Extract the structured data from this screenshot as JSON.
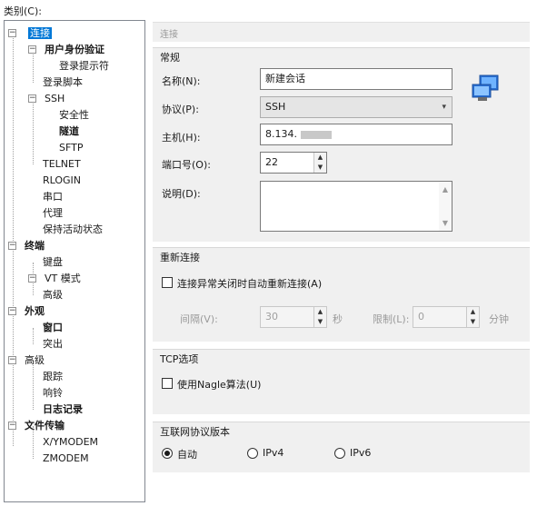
{
  "category_label": "类别(C):",
  "tree": {
    "connection": "连接",
    "user_auth": "用户身份验证",
    "login_prompt": "登录提示符",
    "login_script": "登录脚本",
    "ssh": "SSH",
    "security": "安全性",
    "tunnel": "隧道",
    "sftp": "SFTP",
    "telnet": "TELNET",
    "rlogin": "RLOGIN",
    "serial": "串口",
    "proxy": "代理",
    "keepalive": "保持活动状态",
    "terminal": "终端",
    "keyboard": "键盘",
    "vt_mode": "VT 模式",
    "advanced1": "高级",
    "appearance": "外观",
    "window": "窗口",
    "highlight": "突出",
    "advanced2": "高级",
    "trace": "跟踪",
    "bell": "响铃",
    "logging": "日志记录",
    "file_transfer": "文件传输",
    "xymodem": "X/YMODEM",
    "zmodem": "ZMODEM"
  },
  "header": "连接",
  "general": {
    "title": "常规",
    "name_label": "名称(N):",
    "name_value": "新建会话",
    "protocol_label": "协议(P):",
    "protocol_value": "SSH",
    "host_label": "主机(H):",
    "host_value": "8.134.",
    "port_label": "端口号(O):",
    "port_value": "22",
    "desc_label": "说明(D):"
  },
  "reconnect": {
    "title": "重新连接",
    "checkbox_label": "连接异常关闭时自动重新连接(A)",
    "interval_label": "间隔(V):",
    "interval_value": "30",
    "seconds": "秒",
    "limit_label": "限制(L):",
    "limit_value": "0",
    "minutes": "分钟"
  },
  "tcp": {
    "title": "TCP选项",
    "nagle_label": "使用Nagle算法(U)"
  },
  "ipver": {
    "title": "互联网协议版本",
    "auto": "自动",
    "ipv4": "IPv4",
    "ipv6": "IPv6"
  }
}
